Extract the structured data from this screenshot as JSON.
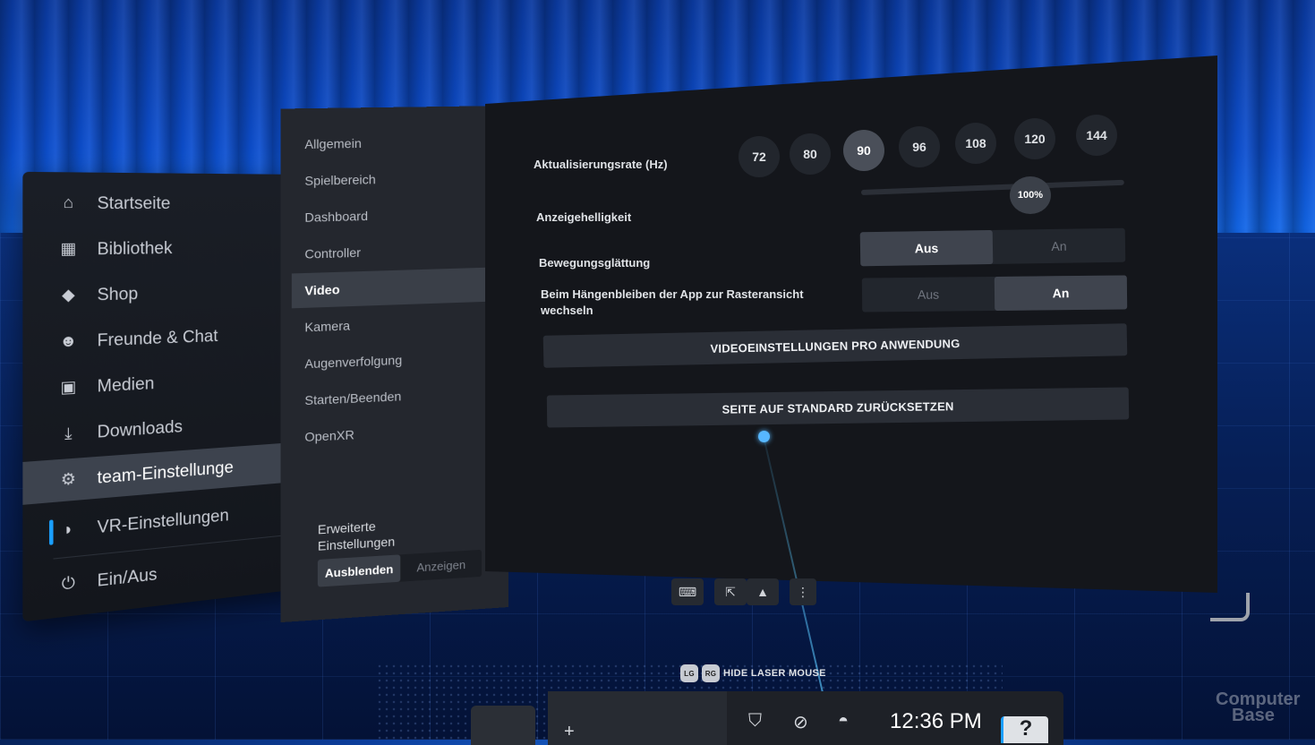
{
  "sidebar": {
    "items": [
      {
        "label": "Startseite"
      },
      {
        "label": "Bibliothek"
      },
      {
        "label": "Shop"
      },
      {
        "label": "Freunde & Chat"
      },
      {
        "label": "Medien"
      },
      {
        "label": "Downloads"
      },
      {
        "label": "team-Einstellunge"
      },
      {
        "label": "VR-Einstellungen"
      },
      {
        "label": "Ein/Aus"
      }
    ]
  },
  "settings_menu": {
    "items": [
      {
        "label": "Allgemein"
      },
      {
        "label": "Spielbereich"
      },
      {
        "label": "Dashboard"
      },
      {
        "label": "Controller"
      },
      {
        "label": "Video"
      },
      {
        "label": "Kamera"
      },
      {
        "label": "Augenverfolgung"
      },
      {
        "label": "Starten/Beenden"
      },
      {
        "label": "OpenXR"
      }
    ],
    "active": "Video",
    "advanced": {
      "title_line1": "Erweiterte",
      "title_line2": "Einstellungen",
      "hide_label": "Ausblenden",
      "show_label": "Anzeigen",
      "selected": "Ausblenden"
    }
  },
  "video": {
    "refresh_rate_label": "Aktualisierungsrate (Hz)",
    "refresh_rates": [
      "72",
      "80",
      "90",
      "96",
      "108",
      "120",
      "144"
    ],
    "selected_rate": "90",
    "brightness_label": "Anzeigehelligkeit",
    "brightness_value": "100%",
    "smoothing_label": "Bewegungsglättung",
    "smoothing_off": "Aus",
    "smoothing_on": "An",
    "smoothing_selected": "Aus",
    "grid_label_line1": "Beim Hängenbleiben der App zur Rasteransicht",
    "grid_label_line2": "wechseln",
    "grid_off": "Aus",
    "grid_on": "An",
    "grid_selected": "An",
    "per_app_button": "VIDEOEINSTELLUNGEN PRO ANWENDUNG",
    "reset_button": "SEITE AUF STANDARD ZURÜCKSETZEN"
  },
  "controller_hint": {
    "left_key": "LG",
    "right_key": "RG",
    "text": "HIDE LASER MOUSE"
  },
  "dashboard": {
    "plus": "+",
    "time": "12:36 PM",
    "help": "?"
  },
  "watermark": {
    "line1": "Computer",
    "line2": "Base"
  },
  "colors": {
    "accent": "#1a9fff",
    "panel_bg": "#14161b",
    "sidebar_bg": "#1a1e26"
  }
}
